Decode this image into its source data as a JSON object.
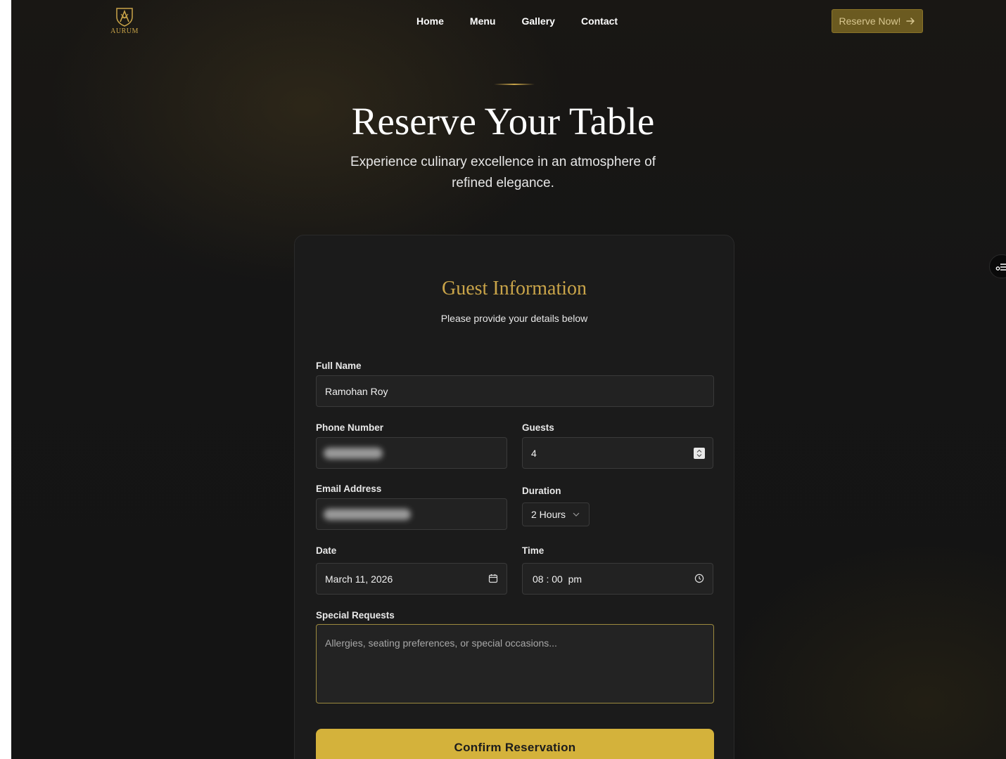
{
  "brand": {
    "name": "AURUM",
    "accent": "#c9a449"
  },
  "nav": {
    "items": [
      "Home",
      "Menu",
      "Gallery",
      "Contact"
    ],
    "cta_label": "Reserve Now!"
  },
  "hero": {
    "title": "Reserve Your Table",
    "subtitle_line1": "Experience culinary excellence in an atmosphere of",
    "subtitle_line2": "refined elegance."
  },
  "form": {
    "title": "Guest Information",
    "subtitle": "Please provide your details below",
    "full_name": {
      "label": "Full Name",
      "value": "Ramohan Roy"
    },
    "phone": {
      "label": "Phone Number",
      "value": ""
    },
    "guests": {
      "label": "Guests",
      "value": "4"
    },
    "email": {
      "label": "Email Address",
      "value": ""
    },
    "duration": {
      "label": "Duration",
      "value": "2 Hours"
    },
    "date": {
      "label": "Date",
      "value": "March 11, 2026"
    },
    "time": {
      "label": "Time",
      "value": "08 : 00  pm"
    },
    "special_requests": {
      "label": "Special Requests",
      "placeholder": "Allergies, seating preferences, or special occasions..."
    },
    "submit_label": "Confirm Reservation"
  }
}
